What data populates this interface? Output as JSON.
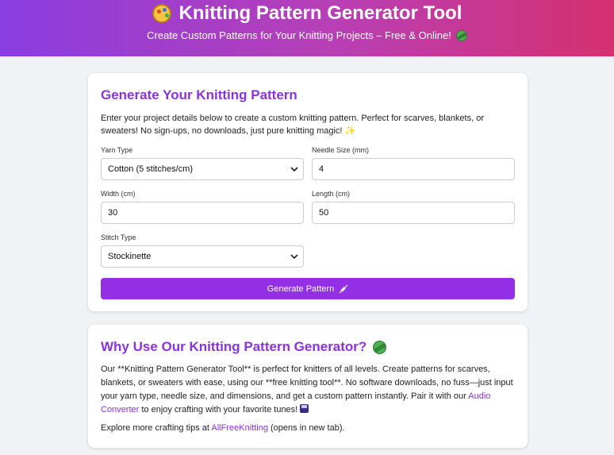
{
  "header": {
    "title": "Knitting Pattern Generator Tool",
    "subtitle": "Create Custom Patterns for Your Knitting Projects – Free & Online!",
    "title_icon": "palette-icon",
    "subtitle_icon": "yarn-ball-icon",
    "gradient_start": "#8a3de0",
    "gradient_end": "#d5306f"
  },
  "generator": {
    "heading": "Generate Your Knitting Pattern",
    "intro": "Enter your project details below to create a custom knitting pattern. Perfect for scarves, blankets, or sweaters! No sign-ups, no downloads, just pure knitting magic!",
    "intro_icon": "sparkles-icon",
    "yarn_type": {
      "label": "Yarn Type",
      "value": "Cotton (5 stitches/cm)"
    },
    "needle_size": {
      "label": "Needle Size (mm)",
      "value": "4"
    },
    "width": {
      "label": "Width (cm)",
      "value": "30"
    },
    "length": {
      "label": "Length (cm)",
      "value": "50"
    },
    "stitch_type": {
      "label": "Stitch Type",
      "value": "Stockinette"
    },
    "button_label": "Generate Pattern",
    "button_icon": "syringe-icon",
    "button_color": "#9330e6"
  },
  "why": {
    "heading": "Why Use Our Knitting Pattern Generator?",
    "heading_icon": "yarn-ball-icon",
    "para1_text": "Our **Knitting Pattern Generator Tool** is perfect for knitters of all levels. Create patterns for scarves, blankets, or sweaters with ease, using our **free knitting tool**. No software downloads, no fuss—just input your yarn type, needle size, and dimensions, and get a custom pattern instantly. Pair it with our ",
    "para1_link": "Audio Converter",
    "para1_tail": " to enjoy crafting with your favorite tunes!",
    "para1_icon": "music-icon",
    "para2_text": "Explore more crafting tips at ",
    "para2_link": "AllFreeKnitting",
    "para2_tail": " (opens in new tab)."
  }
}
